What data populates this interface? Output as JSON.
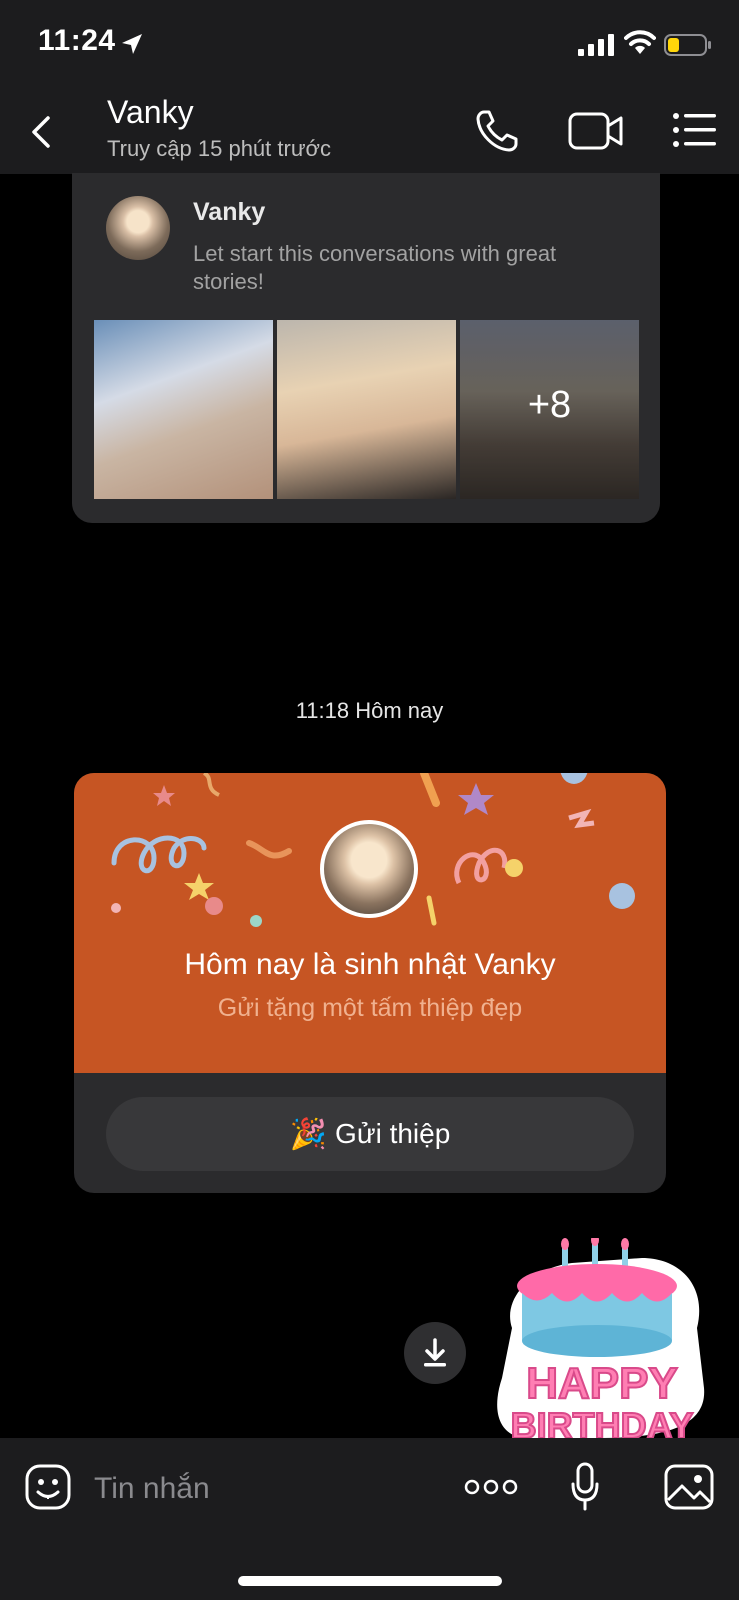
{
  "status_bar": {
    "time": "11:24",
    "icons": [
      "location-arrow-icon",
      "signal-icon",
      "wifi-icon",
      "battery-icon"
    ]
  },
  "header": {
    "contact_name": "Vanky",
    "contact_status": "Truy cập 15 phút trước",
    "icons": [
      "back-icon",
      "phone-icon",
      "video-icon",
      "menu-list-icon"
    ]
  },
  "stories": {
    "name": "Vanky",
    "text": "Let start this conversations with great stories!",
    "more_count": "+8"
  },
  "timestamp": "11:18 Hôm nay",
  "birthday": {
    "title": "Hôm nay là sinh nhật Vanky",
    "subtitle": "Gửi tặng một tấm thiệp đẹp",
    "button_label": "Gửi thiệp",
    "button_emoji": "🎉",
    "banner_color": "#c65523"
  },
  "sticker": {
    "line1": "HAPPY",
    "line2": "BIRTHDAY"
  },
  "composer": {
    "placeholder": "Tin nhắn"
  }
}
